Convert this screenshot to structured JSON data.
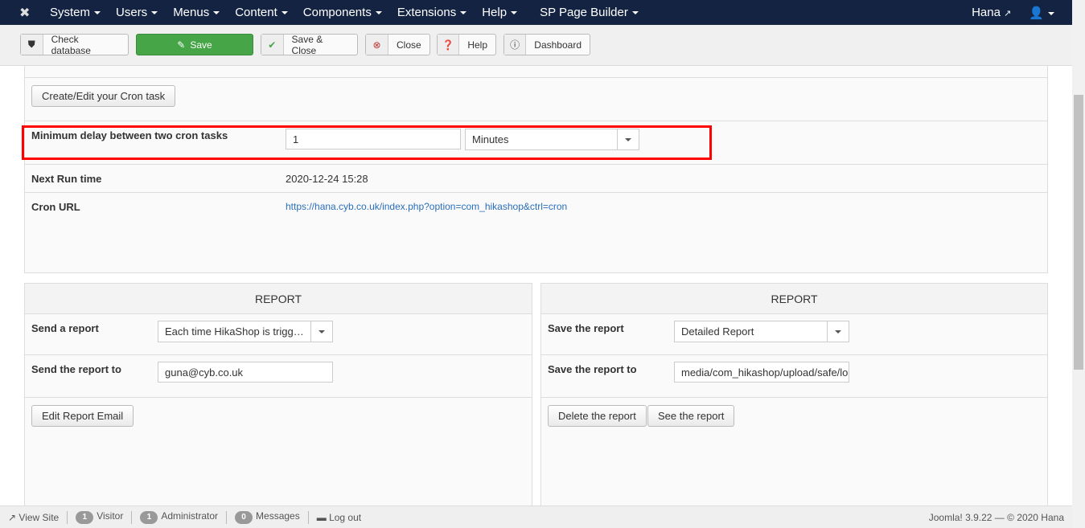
{
  "nav": {
    "items": [
      "System",
      "Users",
      "Menus",
      "Content",
      "Components",
      "Extensions",
      "Help",
      "SP Page Builder"
    ],
    "user": "Hana"
  },
  "toolbar": {
    "check_database": "Check database",
    "save": "Save",
    "save_close": "Save & Close",
    "close": "Close",
    "help": "Help",
    "dashboard": "Dashboard"
  },
  "cron": {
    "create_button": "Create/Edit your Cron task",
    "min_delay_label": "Minimum delay between two cron tasks",
    "min_delay_value": "1",
    "min_delay_unit": "Minutes",
    "next_run_label": "Next Run time",
    "next_run_value": "2020-12-24 15:28",
    "url_label": "Cron URL",
    "url_value": "https://hana.cyb.co.uk/index.php?option=com_hikashop&ctrl=cron",
    "highlight_color": "#ff0000"
  },
  "report_left": {
    "title": "REPORT",
    "send_label": "Send a report",
    "send_value": "Each time HikaShop is triggered",
    "send_to_label": "Send the report to",
    "send_to_value": "guna@cyb.co.uk",
    "edit_button": "Edit Report Email"
  },
  "report_right": {
    "title": "REPORT",
    "save_label": "Save the report",
    "save_value": "Detailed Report",
    "save_to_label": "Save the report to",
    "save_to_value": "media/com_hikashop/upload/safe/logs",
    "delete_button": "Delete the report",
    "see_button": "See the report"
  },
  "status": {
    "view_site": "View Site",
    "visitor_count": "1",
    "visitor": "Visitor",
    "admin_count": "1",
    "admin": "Administrator",
    "messages_count": "0",
    "messages": "Messages",
    "logout": "Log out",
    "version": "Joomla! 3.9.22 — © 2020 Hana"
  }
}
